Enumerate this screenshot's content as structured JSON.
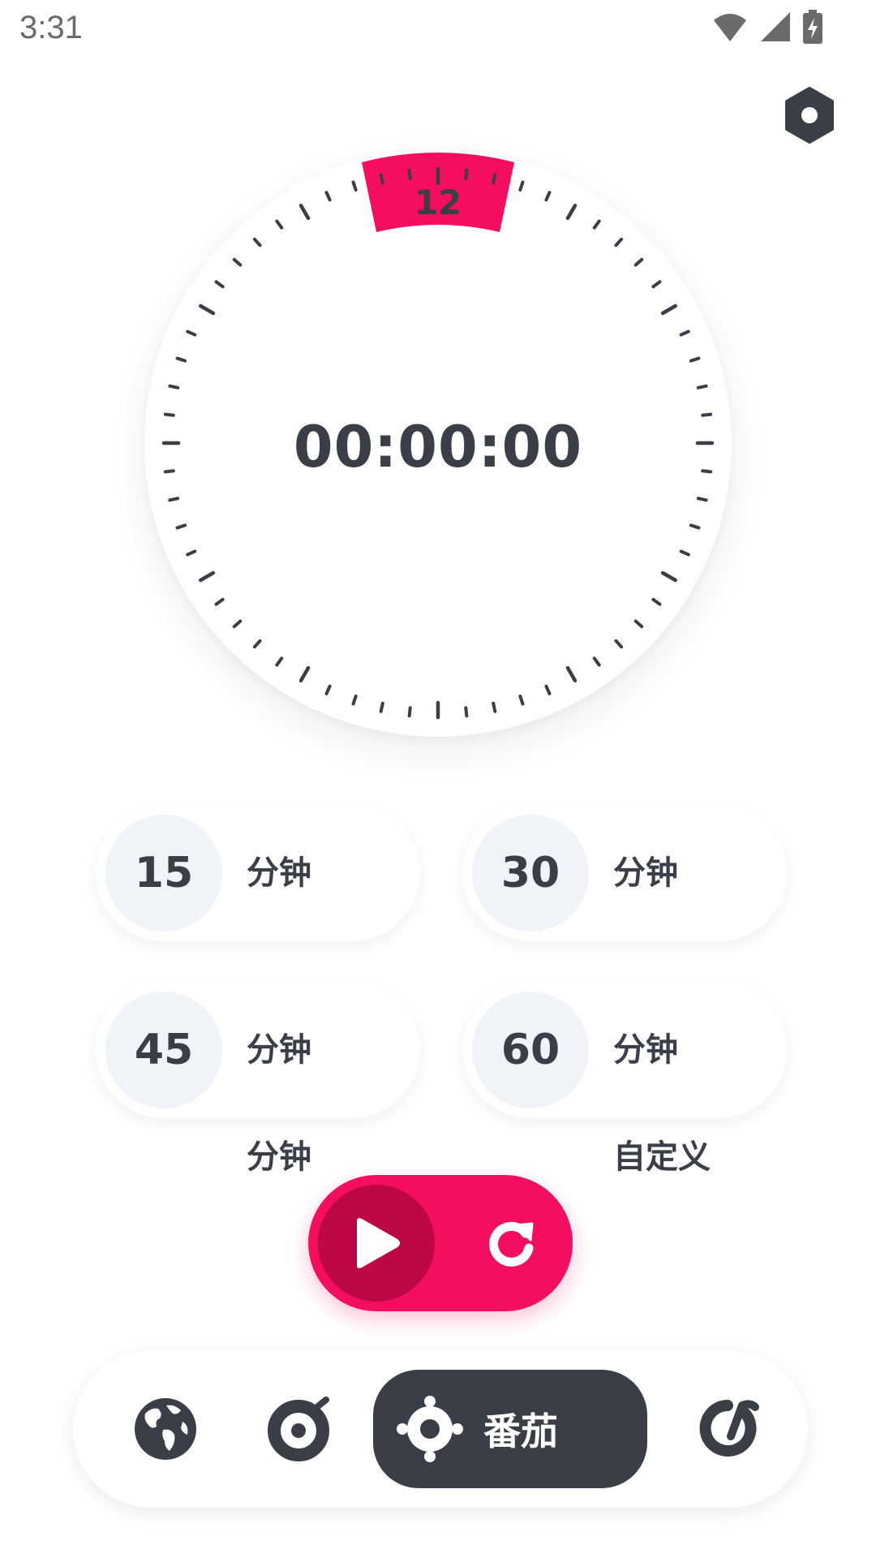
{
  "status_bar": {
    "time": "3:31"
  },
  "timer": {
    "display": "00:00:00",
    "dial_marker": "12"
  },
  "presets": [
    {
      "value": "15",
      "unit": "分钟"
    },
    {
      "value": "30",
      "unit": "分钟"
    },
    {
      "value": "45",
      "unit": "分钟"
    },
    {
      "value": "60",
      "unit": "分钟"
    }
  ],
  "presets_partial": [
    {
      "unit": "分钟"
    },
    {
      "unit": "自定义"
    }
  ],
  "bottom_nav": {
    "active_label": "番茄",
    "items": [
      "globe-icon",
      "stopwatch-icon",
      "tomato-icon",
      "timer-icon"
    ]
  },
  "colors": {
    "accent": "#f50e5f",
    "accent_dark": "#bd0845",
    "dark": "#3a3f47",
    "soft": "#f0f3f8"
  }
}
